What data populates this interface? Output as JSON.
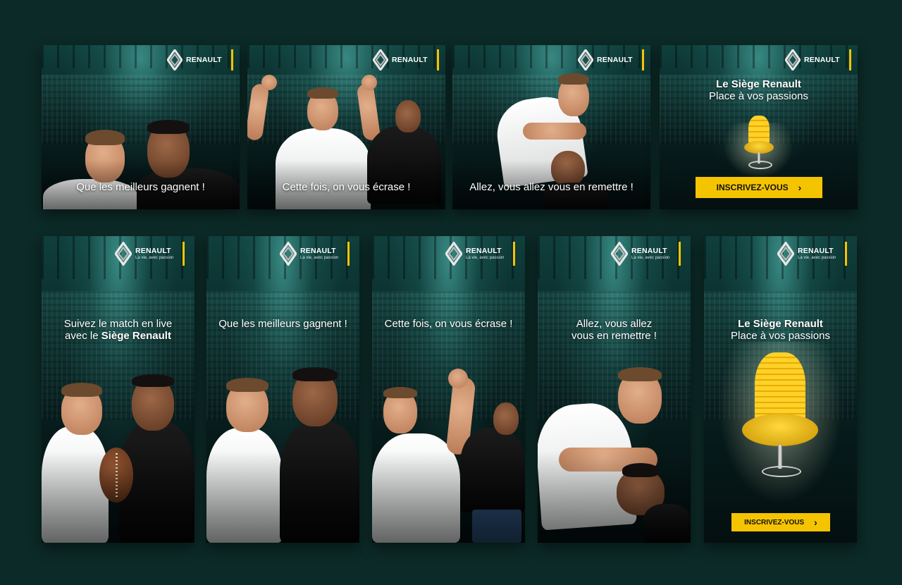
{
  "brand": {
    "name": "RENAULT",
    "tagline": "La vie, avec passion",
    "accent_color": "#f5c400",
    "logo_icon": "renault-diamond-icon"
  },
  "top_row": [
    {
      "caption": "Que les meilleurs gagnent !",
      "scene": "two-players-smiling"
    },
    {
      "caption": "Cette fois, on vous écrase !",
      "scene": "player-flexing"
    },
    {
      "caption": "Allez, vous allez vous en remettre !",
      "scene": "player-headlock"
    },
    {
      "title": "Le Siège Renault",
      "subtitle": "Place à vos passions",
      "cta": "INSCRIVEZ-VOUS",
      "scene": "yellow-seat"
    }
  ],
  "bottom_row": [
    {
      "caption_line1": "Suivez le match en live",
      "caption_line2_prefix": "avec le ",
      "caption_line2_bold": "Siège Renault",
      "scene": "two-players-ball"
    },
    {
      "caption": "Que les meilleurs gagnent !",
      "scene": "two-players-smiling"
    },
    {
      "caption": "Cette fois, on vous écrase !",
      "scene": "player-flexing"
    },
    {
      "caption_line1": "Allez, vous allez",
      "caption_line2": "vous en remettre !",
      "scene": "player-headlock"
    },
    {
      "title": "Le Siège Renault",
      "subtitle": "Place à vos passions",
      "cta": "INSCRIVEZ-VOUS",
      "scene": "yellow-seat"
    }
  ]
}
